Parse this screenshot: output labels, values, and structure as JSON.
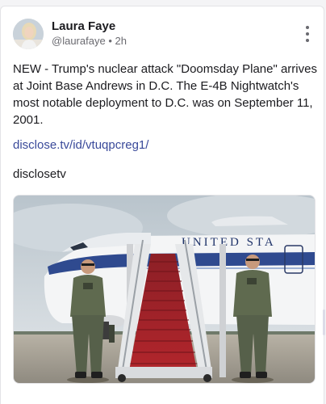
{
  "post": {
    "author_name": "Laura Faye",
    "handle": "@laurafaye",
    "separator": "•",
    "time_ago": "2h",
    "text": "NEW - Trump's nuclear attack \"Doomsday Plane\" arrives at Joint Base Andrews in D.C. The E-4B Nightwatch's most notable deployment to D.C. was on September 11, 2001.",
    "link_text": "disclose.tv/id/vtuqpcreg1/",
    "tag_text": "disclosetv",
    "image": {
      "fuselage_text": "UNITED STA"
    }
  },
  "icons": {
    "menu": "more-vertical-icon"
  },
  "colors": {
    "link": "#3a4a9a",
    "text": "#1b1b1f",
    "muted": "#6a6a70"
  }
}
